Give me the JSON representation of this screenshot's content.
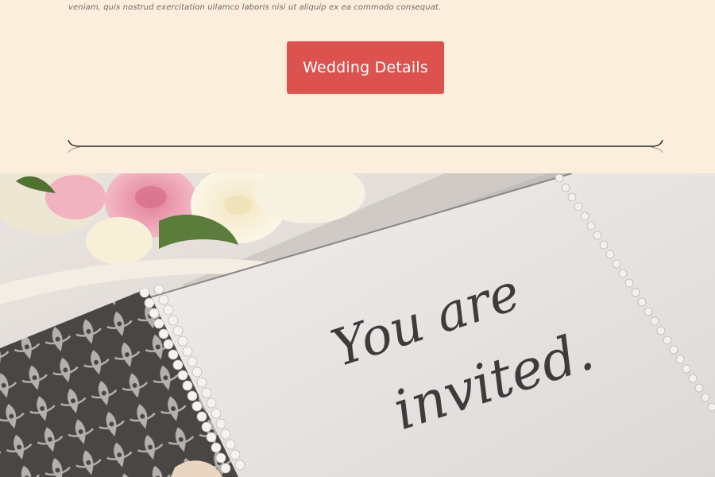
{
  "intro": {
    "body_text": "veniam, quis nostrud exercitation ullamco laboris nisi ut aliquip ex ea commodo consequat."
  },
  "cta": {
    "label": "Wedding Details"
  },
  "hero": {
    "card_line1": "You are",
    "card_line2": "invited."
  },
  "colors": {
    "background": "#fbeedd",
    "accent": "#db524f",
    "divider": "#2a2a2a"
  }
}
